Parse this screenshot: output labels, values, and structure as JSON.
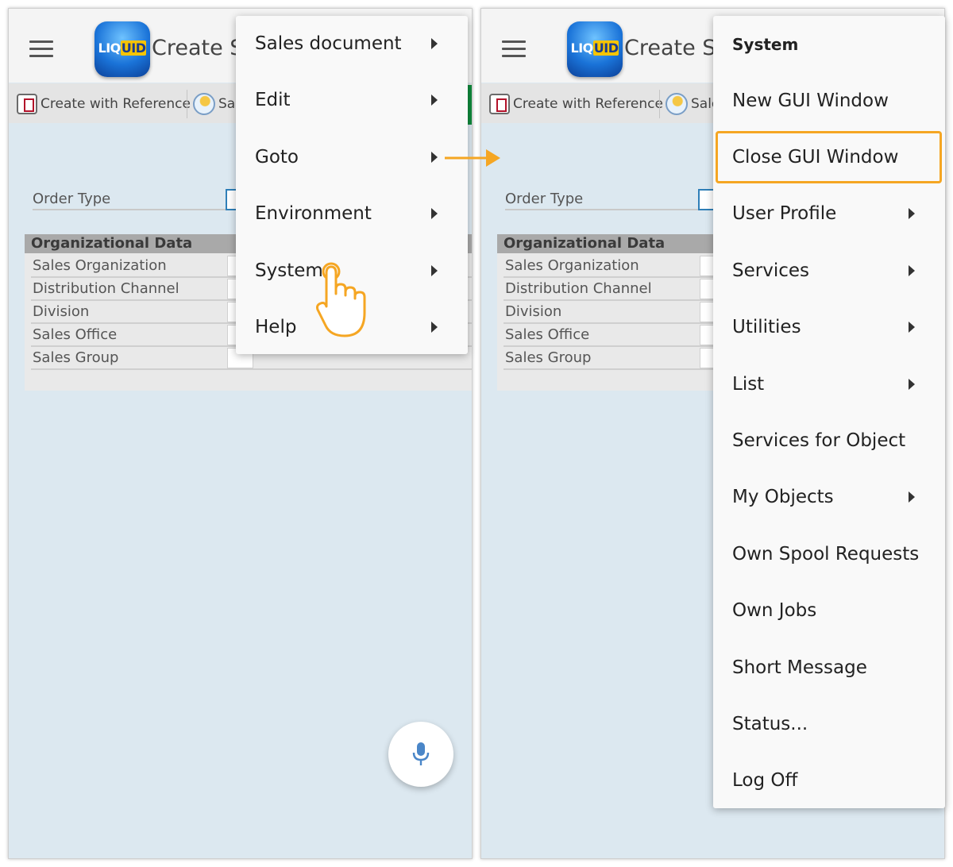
{
  "app": {
    "logo_text_a": "LIQ",
    "logo_text_b": "UID",
    "title": "Create Sa"
  },
  "toolbar": {
    "ref_label": "Create with Reference",
    "sales_label_left": "Sal",
    "sales_label_right": "Sale"
  },
  "form": {
    "order_type_label": "Order Type",
    "org_header": "Organizational Data",
    "org_fields": [
      "Sales Organization",
      "Distribution Channel",
      "Division",
      "Sales Office",
      "Sales Group"
    ]
  },
  "main_menu": {
    "items": [
      {
        "label": "Sales document",
        "has_submenu": true
      },
      {
        "label": "Edit",
        "has_submenu": true
      },
      {
        "label": "Goto",
        "has_submenu": true
      },
      {
        "label": "Environment",
        "has_submenu": true
      },
      {
        "label": "System",
        "has_submenu": true
      },
      {
        "label": "Help",
        "has_submenu": true
      }
    ]
  },
  "system_menu": {
    "title": "System",
    "items": [
      {
        "label": "New GUI Window",
        "has_submenu": false
      },
      {
        "label": "Close GUI Window",
        "has_submenu": false,
        "highlighted": true
      },
      {
        "label": "User Profile",
        "has_submenu": true
      },
      {
        "label": "Services",
        "has_submenu": true
      },
      {
        "label": "Utilities",
        "has_submenu": true
      },
      {
        "label": "List",
        "has_submenu": true
      },
      {
        "label": "Services for Object",
        "has_submenu": false
      },
      {
        "label": "My Objects",
        "has_submenu": true
      },
      {
        "label": "Own Spool Requests",
        "has_submenu": false
      },
      {
        "label": "Own Jobs",
        "has_submenu": false
      },
      {
        "label": "Short Message",
        "has_submenu": false
      },
      {
        "label": "Status...",
        "has_submenu": false
      },
      {
        "label": "Log Off",
        "has_submenu": false
      }
    ]
  },
  "colors": {
    "highlight": "#f5a623",
    "background": "#dce8f0",
    "accent_blue": "#2f7fb8",
    "mic": "#4a86c8"
  }
}
